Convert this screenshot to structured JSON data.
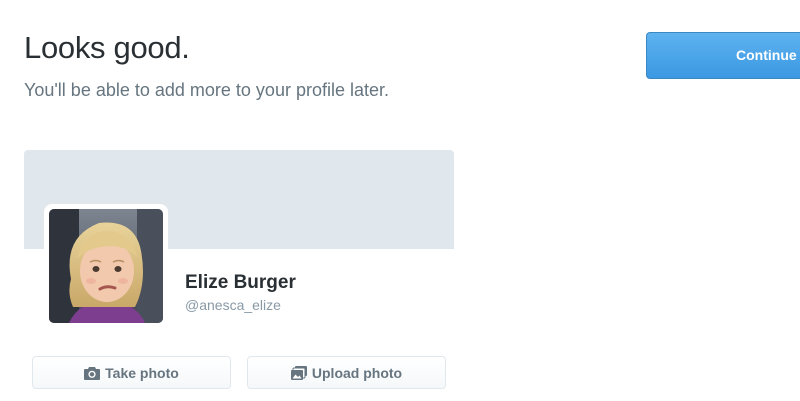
{
  "heading": {
    "title": "Looks good.",
    "subtitle": "You'll be able to add more to your profile later."
  },
  "actions": {
    "continue_label": "Continue",
    "take_photo_label": "Take photo",
    "upload_photo_label": "Upload photo"
  },
  "profile": {
    "name": "Elize Burger",
    "handle": "@anesca_elize"
  },
  "icons": {
    "take_photo": "camera-icon",
    "upload_photo": "photos-icon"
  },
  "colors": {
    "primary_button": "#3b98e2",
    "header_background": "#e1e8ed",
    "text_dark": "#292f33",
    "text_muted": "#66757f"
  }
}
